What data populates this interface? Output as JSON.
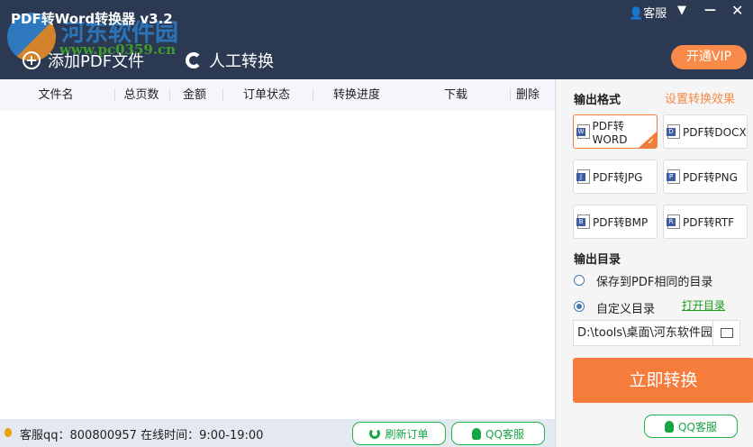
{
  "window": {
    "title": "PDF转Word转换器 v3.2",
    "service": "客服",
    "watermark": "河东软件园",
    "watermark_url": "www.pc0359.cn"
  },
  "toolbar": {
    "add_pdf": "添加PDF文件",
    "manual": "人工转换",
    "vip": "开通VIP"
  },
  "table": {
    "columns": [
      "文件名",
      "总页数",
      "金额",
      "订单状态",
      "转换进度",
      "下载",
      "删除"
    ]
  },
  "status": {
    "text": "客服qq：800800957 在线时间：9:00-19:00",
    "refresh": "刷新订单",
    "qq": "QQ客服"
  },
  "panel": {
    "format_label": "输出格式",
    "effect_link": "设置转换效果",
    "formats": [
      {
        "label": "PDF转WORD",
        "badge": "W"
      },
      {
        "label": "PDF转DOCX",
        "badge": "D"
      },
      {
        "label": "PDF转JPG",
        "badge": "J"
      },
      {
        "label": "PDF转PNG",
        "badge": "P"
      },
      {
        "label": "PDF转BMP",
        "badge": "B"
      },
      {
        "label": "PDF转RTF",
        "badge": "R"
      }
    ],
    "dir_label": "输出目录",
    "opt_same": "保存到PDF相同的目录",
    "opt_custom": "自定义目录",
    "open_dir": "打开目录",
    "path": "D:\\tools\\桌面\\河东软件园",
    "convert": "立即转换",
    "qq": "QQ客服"
  },
  "colors": {
    "header": "#2b3a52",
    "accent": "#f57c3a",
    "green": "#1aa545"
  }
}
